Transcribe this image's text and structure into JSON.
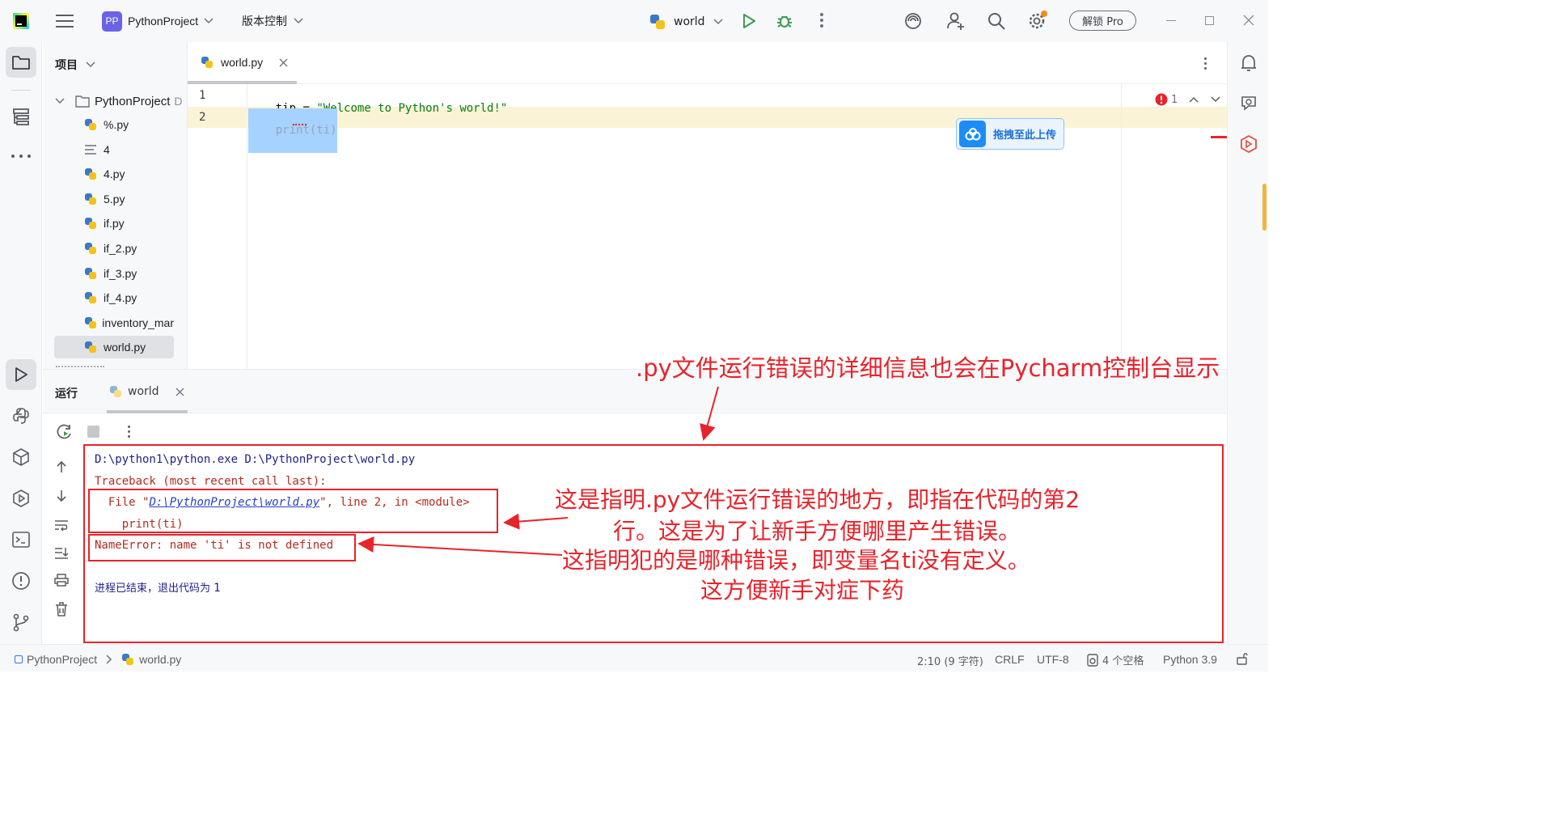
{
  "toolbar": {
    "project_initials": "PP",
    "project_name": "PythonProject",
    "vcs_menu": "版本控制",
    "run_config": "world",
    "unlock_pro": "解锁 Pro"
  },
  "project_panel": {
    "title": "项目",
    "root": "PythonProject",
    "root_suffix": "D",
    "files": [
      {
        "name": "%.py",
        "type": "py"
      },
      {
        "name": "4",
        "type": "text"
      },
      {
        "name": "4.py",
        "type": "py"
      },
      {
        "name": "5.py",
        "type": "py"
      },
      {
        "name": "if.py",
        "type": "py"
      },
      {
        "name": "if_2.py",
        "type": "py"
      },
      {
        "name": "if_3.py",
        "type": "py"
      },
      {
        "name": "if_4.py",
        "type": "py"
      },
      {
        "name": "inventory_mar",
        "type": "py"
      },
      {
        "name": "world.py",
        "type": "py",
        "selected": true
      }
    ]
  },
  "editor": {
    "tab_label": "world.py",
    "lines": [
      {
        "num": "1",
        "tip": "tip",
        "eq": " = ",
        "str": "\"Welcome to Python's world!\""
      },
      {
        "num": "2",
        "code": "print(ti)"
      }
    ],
    "error_count": "1",
    "upload_label": "拖拽至此上传"
  },
  "run_panel": {
    "title": "运行",
    "tab_label": "world",
    "console": {
      "cmd": "D:\\python1\\python.exe D:\\PythonProject\\world.py",
      "traceback": "Traceback (most recent call last):",
      "file_prefix": "  File \"",
      "file_link": "D:\\PythonProject\\world.py",
      "file_suffix": "\", line 2, in <module>",
      "code_line": "    print(ti)",
      "error": "NameError: name 'ti' is not defined",
      "exit": "进程已结束，退出代码为 ",
      "exit_code": "1"
    }
  },
  "annotations": {
    "top": ".py文件运行错误的详细信息也会在Pycharm控制台显示",
    "mid_line1": "这是指明.py文件运行错误的地方，即指在代码的第2",
    "mid_line2": "行。这是为了让新手方便哪里产生错误。",
    "low_line1": "这指明犯的是哪种错误，即变量名ti没有定义。",
    "low_line2": "这方便新手对症下药"
  },
  "status_bar": {
    "breadcrumb_project": "PythonProject",
    "breadcrumb_file": "world.py",
    "position": "2:10 (9 字符)",
    "line_sep": "CRLF",
    "encoding": "UTF-8",
    "indent": "4 个空格",
    "interpreter": "Python 3.9"
  },
  "colors": {
    "accent": "#3574f0",
    "error_red": "#e8232a",
    "run_green": "#3d9a50",
    "highlight_line": "#fbf3d5",
    "selection": "#a6d2ff",
    "string": "#067d17"
  }
}
